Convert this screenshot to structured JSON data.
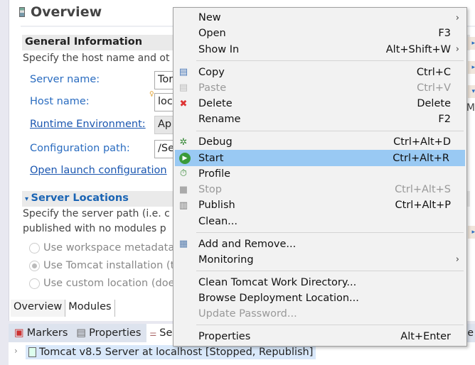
{
  "editor": {
    "title": "Overview",
    "general": {
      "heading": "General Information",
      "desc": "Specify the host name and ot",
      "fields": [
        {
          "label": "Server name:",
          "value": "Tor",
          "link": false
        },
        {
          "label": "Host name:",
          "value": "loc",
          "link": false
        },
        {
          "label": "Runtime Environment:",
          "value": "Ap",
          "link": true
        },
        {
          "label": "Configuration path:",
          "value": "/Se",
          "link": false
        }
      ],
      "launch_link": "Open launch configuration"
    },
    "locations": {
      "heading": "Server Locations",
      "desc1": "Specify the server path (i.e. c",
      "desc2": "published with no modules p",
      "options": [
        {
          "label": "Use workspace metadata",
          "selected": false
        },
        {
          "label": "Use Tomcat installation (t",
          "selected": true
        },
        {
          "label": "Use custom location (doe",
          "selected": false
        }
      ]
    },
    "right_m": "M",
    "tabs": [
      "Overview",
      "Modules"
    ]
  },
  "views": {
    "tabs": [
      "Markers",
      "Properties",
      "Se"
    ],
    "right_text": "e"
  },
  "servers": {
    "row": "Tomcat v8.5 Server at localhost  [Stopped, Republish]"
  },
  "menu": {
    "items": [
      {
        "label": "New",
        "submenu": true
      },
      {
        "label": "Open",
        "accel": "F3"
      },
      {
        "label": "Show In",
        "accel": "Alt+Shift+W",
        "submenu": true
      },
      {
        "sep": true
      },
      {
        "label": "Copy",
        "accel": "Ctrl+C",
        "icon": "copy-icon"
      },
      {
        "label": "Paste",
        "accel": "Ctrl+V",
        "icon": "paste-icon",
        "disabled": true
      },
      {
        "label": "Delete",
        "accel": "Delete",
        "icon": "delete-icon"
      },
      {
        "label": "Rename",
        "accel": "F2"
      },
      {
        "sep": true
      },
      {
        "label": "Debug",
        "accel": "Ctrl+Alt+D",
        "icon": "debug-icon"
      },
      {
        "label": "Start",
        "accel": "Ctrl+Alt+R",
        "icon": "start-icon",
        "highlighted": true
      },
      {
        "label": "Profile",
        "icon": "profile-icon"
      },
      {
        "label": "Stop",
        "accel": "Ctrl+Alt+S",
        "icon": "stop-icon",
        "disabled": true
      },
      {
        "label": "Publish",
        "accel": "Ctrl+Alt+P",
        "icon": "publish-icon"
      },
      {
        "label": "Clean..."
      },
      {
        "sep": true
      },
      {
        "label": "Add and Remove...",
        "icon": "add-remove-icon"
      },
      {
        "label": "Monitoring",
        "submenu": true
      },
      {
        "sep": true
      },
      {
        "label": "Clean Tomcat Work Directory..."
      },
      {
        "label": "Browse Deployment Location..."
      },
      {
        "label": "Update Password...",
        "disabled": true
      },
      {
        "sep": true
      },
      {
        "label": "Properties",
        "accel": "Alt+Enter"
      }
    ]
  },
  "colors": {
    "highlight": "#99c9f3",
    "link": "#1a64b4"
  }
}
